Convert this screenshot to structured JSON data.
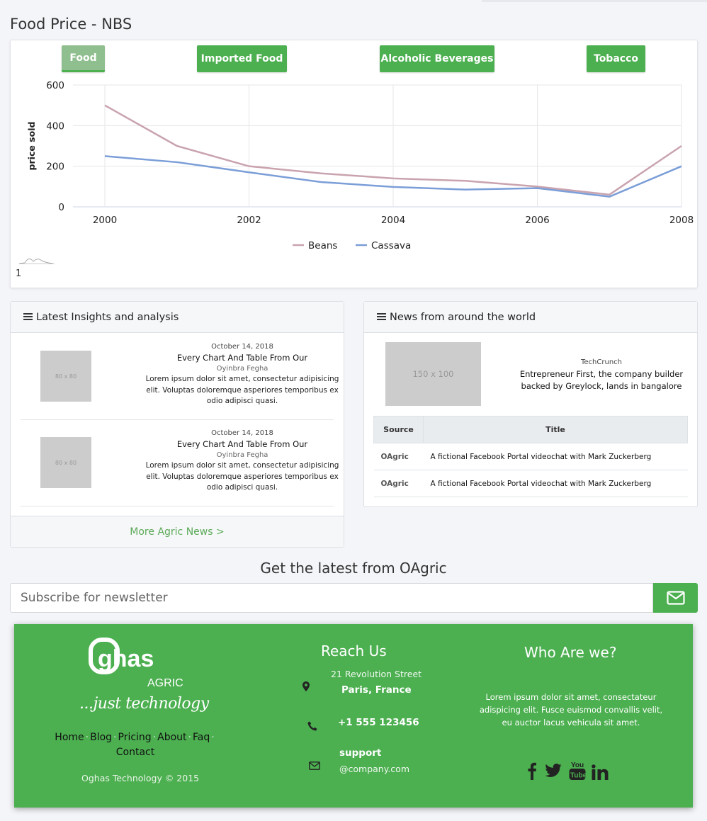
{
  "page": {
    "title": "Food Price - NBS"
  },
  "chart_tabs": [
    {
      "label": "Food",
      "active": true
    },
    {
      "label": "Imported Food",
      "active": false
    },
    {
      "label": "Alcoholic Beverages",
      "active": false
    },
    {
      "label": "Tobacco",
      "active": false
    }
  ],
  "chart_data": {
    "type": "line",
    "x": [
      2000,
      2001,
      2002,
      2003,
      2004,
      2005,
      2006,
      2007,
      2008
    ],
    "x_ticks": [
      "2000",
      "2002",
      "2004",
      "2006",
      "2008"
    ],
    "y_ticks": [
      "0",
      "200",
      "400",
      "600"
    ],
    "ylim": [
      0,
      600
    ],
    "xlim": [
      2000,
      2008
    ],
    "ylabel": "price sold",
    "xlabel": "",
    "grid": true,
    "legend_position": "bottom",
    "series": [
      {
        "name": "Beans",
        "color": "#c9a3ae",
        "values": [
          500,
          300,
          200,
          165,
          140,
          128,
          100,
          60,
          300
        ]
      },
      {
        "name": "Cassava",
        "color": "#7b9ed8",
        "values": [
          250,
          220,
          170,
          122,
          98,
          85,
          92,
          50,
          200
        ]
      }
    ]
  },
  "chart_page_number": "1",
  "insights": {
    "heading": "Latest Insights and analysis",
    "items": [
      {
        "date": "October 14, 2018",
        "title": "Every Chart And Table From Our",
        "author": "Oyinbra Fegha",
        "body": "Lorem ipsum dolor sit amet, consectetur adipisicing elit. Voluptas doloremque asperiores temporibus ex odio adipisci quasi.",
        "thumb": "80 x 80"
      },
      {
        "date": "October 14, 2018",
        "title": "Every Chart And Table From Our",
        "author": "Oyinbra Fegha",
        "body": "Lorem ipsum dolor sit amet, consectetur adipisicing elit. Voluptas doloremque asperiores temporibus ex odio adipisci quasi.",
        "thumb": "80 x 80"
      }
    ],
    "more_link": "More Agric News >"
  },
  "news": {
    "heading": "News from around the world",
    "feature": {
      "thumb": "150 x 100",
      "source": "TechCrunch",
      "headline": "Entrepreneur First, the company builder backed by Greylock, lands in bangalore"
    },
    "table_headers": {
      "source": "Source",
      "title": "Title"
    },
    "rows": [
      {
        "source": "OAgric",
        "title": "A fictional Facebook Portal videochat with Mark Zuckerberg"
      },
      {
        "source": "OAgric",
        "title": "A fictional Facebook Portal videochat with Mark Zuckerberg"
      }
    ]
  },
  "newsletter": {
    "title": "Get the latest from OAgric",
    "placeholder": "Subscribe for newsletter",
    "button_icon": "envelope-icon"
  },
  "footer": {
    "logo_text": "ghas",
    "logo_sub": "AGRIC",
    "tagline": "...just technology",
    "links": [
      "Home",
      "Blog",
      "Pricing",
      "About",
      "Faq",
      "Contact"
    ],
    "copyright": "Oghas Technology © 2015",
    "reach_title": "Reach Us",
    "address_line1": "21 Revolution Street",
    "address_line2": "Paris, France",
    "phone": "+1 555 123456",
    "email_line1": "support",
    "email_line2": "@company.com",
    "who_title": "Who Are we?",
    "who_body": "Lorem ipsum dolor sit amet, consectateur adispicing elit. Fusce euismod convallis velit, eu auctor lacus vehicula sit amet.",
    "social": [
      "facebook-icon",
      "twitter-icon",
      "youtube-icon",
      "linkedin-icon"
    ]
  },
  "colors": {
    "accent": "#4caf50",
    "link": "#5caa58",
    "beans": "#c9a3ae",
    "cassava": "#7b9ed8"
  }
}
